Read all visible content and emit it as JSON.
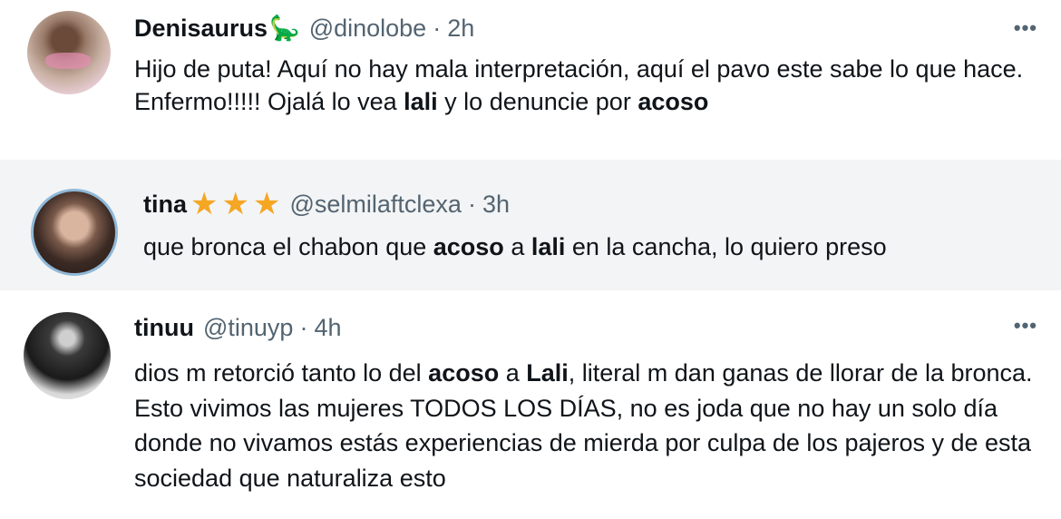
{
  "tweets": [
    {
      "name": "Denisaurus",
      "name_emoji": "🦕",
      "handle": "@dinolobe",
      "separator": "·",
      "time": "2h",
      "more": "•••",
      "text_parts": [
        "Hijo de puta! Aquí no hay mala interpretación, aquí el pavo este sabe lo que hace. Enfermo!!!!! Ojalá lo vea ",
        "lali",
        " y lo denuncie por ",
        "acoso"
      ]
    },
    {
      "name": "tina",
      "stars": [
        "★",
        "★",
        "★"
      ],
      "handle": "@selmilaftclexa",
      "separator": "·",
      "time": "3h",
      "text_parts": [
        "que bronca el chabon que ",
        "acoso",
        " a ",
        "lali",
        " en la cancha, lo quiero preso"
      ]
    },
    {
      "name": "tinuu",
      "handle": "@tinuyp",
      "separator": "·",
      "time": "4h",
      "more": "•••",
      "text_parts": [
        "dios m retorció tanto lo del ",
        "acoso",
        " a ",
        "Lali",
        ", literal m dan ganas de llorar de la bronca. Esto vivimos las mujeres TODOS LOS DÍAS, no es joda que no hay un solo día donde no vivamos estás experiencias de mierda por culpa de los pajeros y de esta sociedad que naturaliza esto"
      ]
    }
  ],
  "colors": {
    "text": "#0f1419",
    "secondary": "#536471",
    "star": "#f5a623",
    "highlight_bg": "#f3f4f5"
  }
}
